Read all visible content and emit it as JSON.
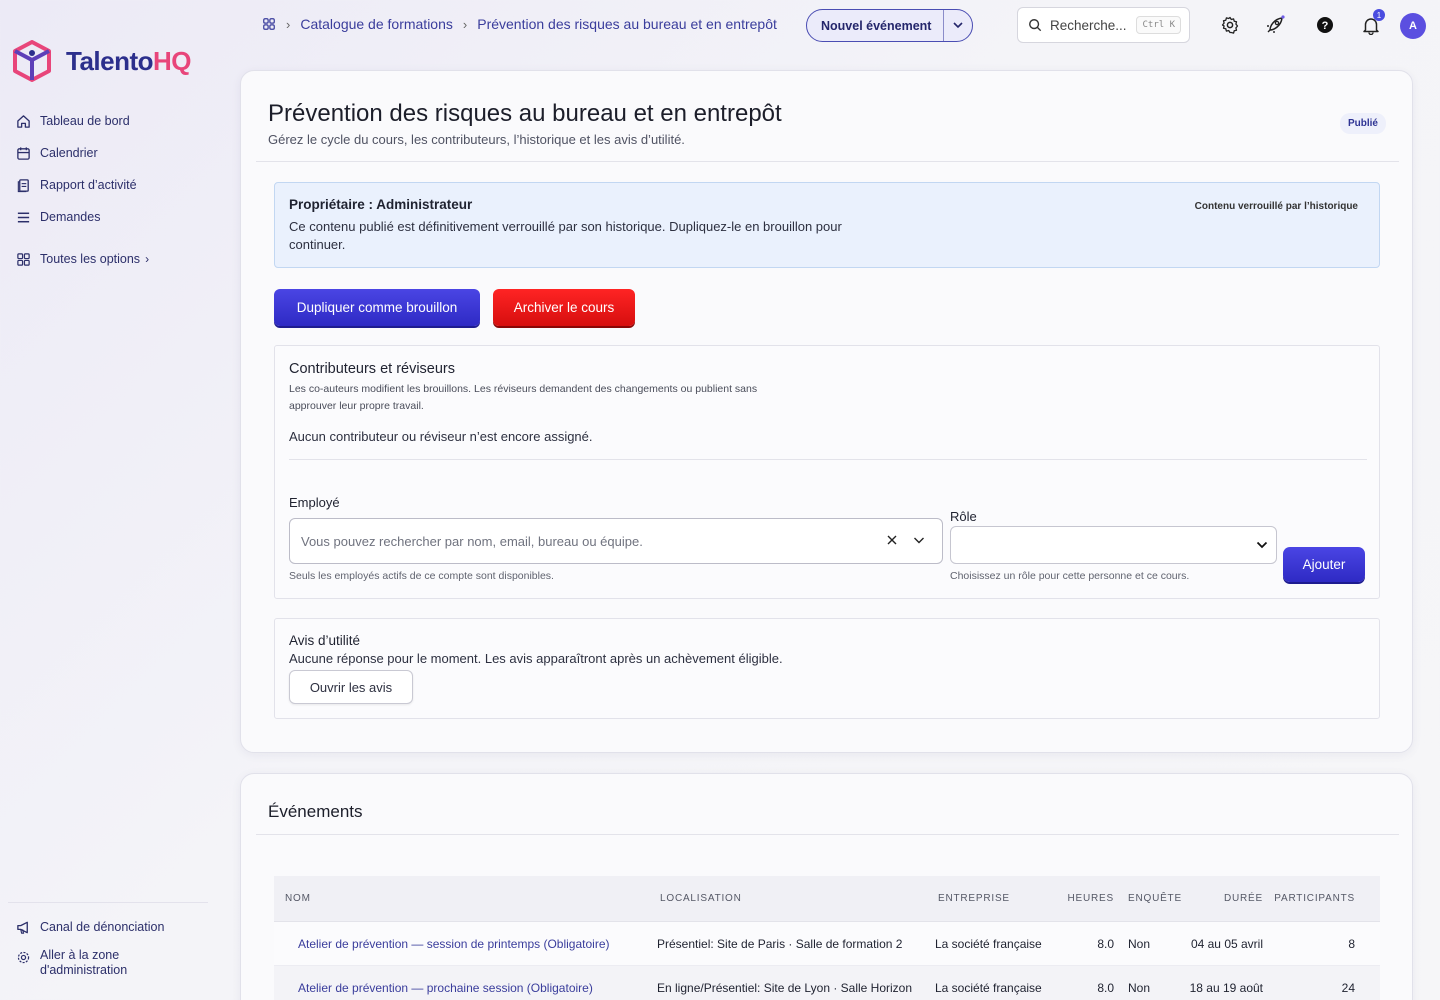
{
  "brand": {
    "name_main": "Talento",
    "name_accent": "HQ"
  },
  "sidebar": {
    "items": [
      {
        "label": "Tableau de bord",
        "icon": "home-icon"
      },
      {
        "label": "Calendrier",
        "icon": "calendar-icon"
      },
      {
        "label": "Rapport d’activité",
        "icon": "report-icon"
      },
      {
        "label": "Demandes",
        "icon": "list-icon"
      }
    ],
    "all_options": "Toutes les options",
    "bottom": [
      {
        "label": "Canal de dénonciation",
        "icon": "megaphone-icon"
      },
      {
        "label": "Aller à la zone d'administration",
        "icon": "admin-gear-icon"
      }
    ]
  },
  "header": {
    "breadcrumb": [
      "Catalogue de formations",
      "Prévention des risques au bureau et en entrepôt"
    ],
    "new_event": "Nouvel événement",
    "search_placeholder": "Recherche...",
    "search_shortcut": "Ctrl K",
    "notifications_count": "1",
    "avatar_initial": "A"
  },
  "course": {
    "title": "Prévention des risques au bureau et en entrepôt",
    "subtitle": "Gérez le cycle du cours, les contributeurs, l’historique et les avis d’utilité.",
    "status": "Publié",
    "owner": "Propriétaire : Administrateur",
    "lock_message": "Ce contenu publié est définitivement verrouillé par son historique. Dupliquez-le en brouillon pour continuer.",
    "lock_tag": "Contenu verrouillé par l’historique",
    "duplicate_button": "Dupliquer comme brouillon",
    "archive_button": "Archiver le cours"
  },
  "contributors": {
    "title": "Contributeurs et réviseurs",
    "description": "Les co-auteurs modifient les brouillons. Les réviseurs demandent des changements ou publient sans approuver leur propre travail.",
    "empty": "Aucun contributeur ou réviseur n’est encore assigné.",
    "employee_label": "Employé",
    "employee_placeholder": "Vous pouvez rechercher par nom, email, bureau ou équipe.",
    "employee_hint": "Seuls les employés actifs de ce compte sont disponibles.",
    "role_label": "Rôle",
    "role_value": "",
    "role_hint": "Choisissez un rôle pour cette personne et ce cours.",
    "add_button": "Ajouter"
  },
  "reviews": {
    "title": "Avis d’utilité",
    "empty": "Aucune réponse pour le moment. Les avis apparaîtront après un achèvement éligible.",
    "open_button": "Ouvrir les avis"
  },
  "events": {
    "title": "Événements",
    "columns": [
      "NOM",
      "LOCALISATION",
      "ENTREPRISE",
      "HEURES",
      "ENQUÊTE",
      "DURÉE",
      "PARTICIPANTS"
    ],
    "rows": [
      [
        "Atelier de prévention — session de printemps (Obligatoire)",
        "Présentiel: Site de Paris · Salle de formation 2",
        "La société française",
        "8.0",
        "Non",
        "04 au 05 avril",
        "8"
      ],
      [
        "Atelier de prévention — prochaine session (Obligatoire)",
        "En ligne/Présentiel: Site de Lyon · Salle Horizon",
        "La société française",
        "8.0",
        "Non",
        "18 au 19 août",
        "24"
      ]
    ]
  },
  "colors": {
    "accent": "#3a36d6",
    "danger": "#e81515",
    "brand_pink": "#e8457a",
    "brand_navy": "#2c2f8c"
  }
}
